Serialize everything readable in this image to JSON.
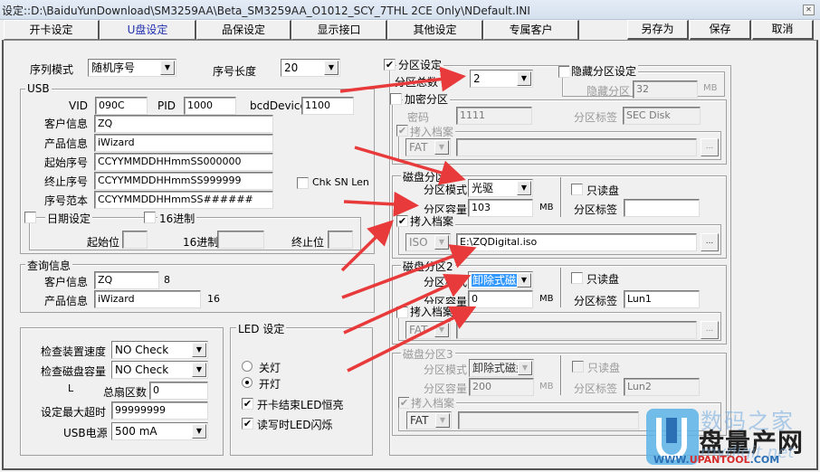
{
  "window": {
    "title": "设定::D:\\BaiduYunDownload\\SM3259AA\\Beta_SM3259AA_O1012_SCY_7THL 2CE Only\\NDefault.INI",
    "close_icon": "close-icon"
  },
  "tabs": [
    {
      "label": "开卡设定",
      "active": false
    },
    {
      "label": "U盘设定",
      "active": true
    },
    {
      "label": "品保设定",
      "active": false
    },
    {
      "label": "显示接口",
      "active": false
    },
    {
      "label": "其他设定",
      "active": false
    },
    {
      "label": "专属客户",
      "active": false
    }
  ],
  "actions": {
    "save_as": "另存为",
    "save": "保存",
    "cancel": "取消"
  },
  "serial": {
    "mode_label": "序列模式",
    "mode_value": "随机序号",
    "length_label": "序号长度",
    "length_value": "20"
  },
  "usb": {
    "group_label": "USB",
    "vid_label": "VID",
    "vid": "090C",
    "pid_label": "PID",
    "pid": "1000",
    "bcd_label": "bcdDevice",
    "bcd": "1100",
    "customer_label": "客户信息",
    "customer": "ZQ",
    "product_label": "产品信息",
    "product": "iWizard",
    "start_sn_label": "起始序号",
    "start_sn": "CCYYMMDDHHmmSS000000",
    "end_sn_label": "终止序号",
    "end_sn": "CCYYMMDDHHmmSS999999",
    "sample_sn_label": "序号范本",
    "sample_sn": "CCYYMMDDHHmmSS######",
    "chk_sn_len": "Chk SN Len",
    "date_setting": "日期设定",
    "hex_label": "16进制",
    "start_pos_label": "起始位",
    "hex_field_label": "16进制",
    "end_pos_label": "终止位"
  },
  "query": {
    "group_label": "查询信息",
    "customer_label": "客户信息",
    "customer": "ZQ",
    "customer_len": "8",
    "product_label": "产品信息",
    "product": "iWizard",
    "product_len": "16"
  },
  "checks": {
    "speed_label": "检查装置速度",
    "speed": "NO Check",
    "capacity_label": "检查磁盘容量",
    "capacity": "NO Check",
    "l_label": "L",
    "sectors_label": "总扇区数",
    "sectors": "0",
    "timeout_label": "设定最大超时",
    "timeout": "99999999",
    "power_label": "USB电源",
    "power": "500 mA"
  },
  "led": {
    "group_label": "LED 设定",
    "off": "关灯",
    "on": "开灯",
    "selected": "on",
    "steady_on": "开卡结束LED恒亮",
    "steady_on_checked": true,
    "blink_rw": "读写时LED闪烁",
    "blink_rw_checked": true
  },
  "partition": {
    "enabled": true,
    "group_label": "分区设定",
    "count_label": "分区总数",
    "count": "2",
    "hidden": {
      "label": "隐藏分区设定",
      "checked": false,
      "size_label": "隐藏分区",
      "size": "32",
      "unit": "MB"
    },
    "encrypted": {
      "label": "加密分区",
      "checked": false,
      "password_label": "密码",
      "password": "1111",
      "tag_label": "分区标签",
      "tag": "SEC Disk",
      "copy_label": "拷入档案",
      "copy_checked": true,
      "fs": "FAT",
      "path": "",
      "browse": "..."
    },
    "disks": [
      {
        "label": "磁盘分区",
        "mode_label": "分区模式",
        "mode": "光驱",
        "size_label": "分区容量",
        "size": "103",
        "unit": "MB",
        "readonly_label": "只读盘",
        "readonly": false,
        "tag_label": "分区标签",
        "tag": "",
        "copy_label": "拷入档案",
        "copy_checked": true,
        "fs": "ISO",
        "path": "E:\\ZQDigital.iso",
        "browse": "...",
        "disabled": false
      },
      {
        "label": "磁盘分区2",
        "mode_label": "分区模式",
        "mode": "卸除式磁盘",
        "size_label": "分区容量",
        "size": "0",
        "unit": "MB",
        "readonly_label": "只读盘",
        "readonly": false,
        "tag_label": "分区标签",
        "tag": "Lun1",
        "copy_label": "拷入档案",
        "copy_checked": false,
        "fs": "FAT",
        "path": "",
        "browse": "...",
        "disabled": false
      },
      {
        "label": "磁盘分区3",
        "mode_label": "分区模式",
        "mode": "卸除式磁盘",
        "size_label": "分区容量",
        "size": "200",
        "unit": "MB",
        "readonly_label": "只读盘",
        "readonly": false,
        "tag_label": "分区标签",
        "tag": "Lun2",
        "copy_label": "拷入档案",
        "copy_checked": true,
        "fs": "FAT",
        "path": "",
        "browse": "...",
        "disabled": true
      }
    ]
  },
  "watermark": {
    "line1": "数码之家",
    "line2": "盘量产网",
    "url": "WWW.UPANTOOL.COM",
    "url_prefix": "WWW.",
    "url_main": "UPANTOOL",
    "url_suffix": ".COM",
    "faint": "mydigit.net"
  },
  "annotation": {
    "arrow_color": "#e83a3a"
  }
}
